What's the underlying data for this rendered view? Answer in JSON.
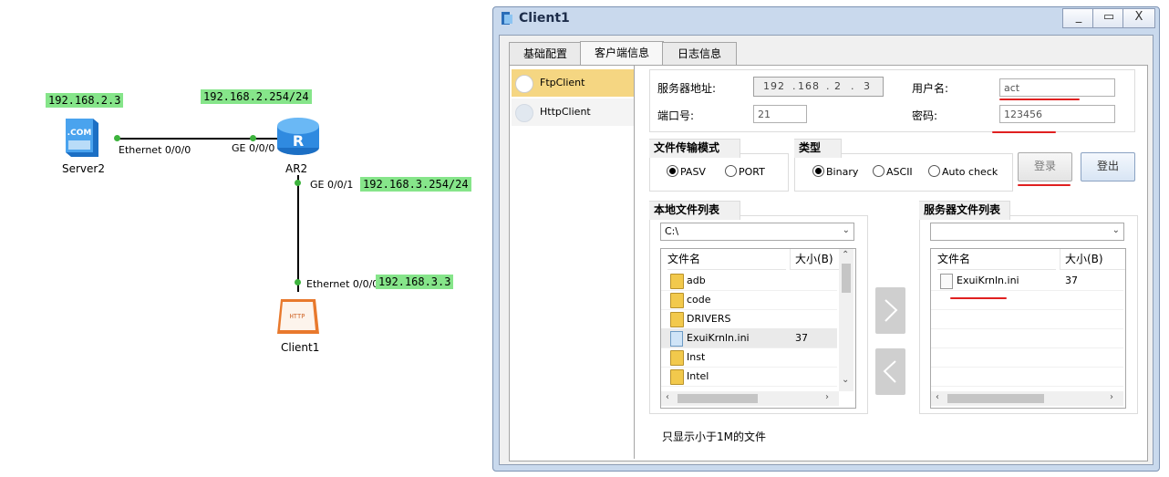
{
  "topology": {
    "devices": {
      "server2": "Server2",
      "ar2": "AR2",
      "client1": "Client1",
      "server_icon_text": ".COM",
      "client_icon_text": "HTTP"
    },
    "ip_labels": {
      "server2": "192.168.2.3",
      "ar2_ge000": "192.168.2.254/24",
      "ar2_ge001": "192.168.3.254/24",
      "client1": "192.168.3.3"
    },
    "ports": {
      "server2_eth": "Ethernet 0/0/0",
      "ar2_ge000": "GE 0/0/0",
      "ar2_ge001": "GE 0/0/1",
      "client1_eth": "Ethernet 0/0/0"
    }
  },
  "window": {
    "title": "Client1",
    "controls": {
      "minimize": "_",
      "maximize": "▭",
      "close": "X"
    },
    "tabs": [
      "基础配置",
      "客户端信息",
      "日志信息"
    ],
    "active_tab": 1,
    "sidebar": {
      "items": [
        "FtpClient",
        "HttpClient"
      ],
      "selected": 0
    },
    "ftp": {
      "server_addr_label": "服务器地址:",
      "server_addr_octets": [
        "192",
        "168",
        "2",
        "3"
      ],
      "port_label": "端口号:",
      "port_value": "21",
      "username_label": "用户名:",
      "username_value": "act",
      "password_label": "密码:",
      "password_value": "123456",
      "mode_group": {
        "title": "文件传输模式",
        "options": [
          "PASV",
          "PORT"
        ],
        "selected": "PASV"
      },
      "type_group": {
        "title": "类型",
        "options": [
          "Binary",
          "ASCII",
          "Auto check"
        ],
        "selected": "Binary"
      },
      "login_button": "登录",
      "logout_button": "登出",
      "local": {
        "title": "本地文件列表",
        "path": "C:\\",
        "columns": [
          "文件名",
          "大小(B)"
        ],
        "rows": [
          {
            "name": "adb",
            "size": "",
            "type": "folder"
          },
          {
            "name": "code",
            "size": "",
            "type": "folder"
          },
          {
            "name": "DRIVERS",
            "size": "",
            "type": "folder"
          },
          {
            "name": "ExuiKrnln.ini",
            "size": "37",
            "type": "file"
          },
          {
            "name": "Inst",
            "size": "",
            "type": "folder"
          },
          {
            "name": "Intel",
            "size": "",
            "type": "folder"
          }
        ]
      },
      "remote": {
        "title": "服务器文件列表",
        "path": "",
        "columns": [
          "文件名",
          "大小(B)"
        ],
        "rows": [
          {
            "name": "ExuiKrnln.ini",
            "size": "37",
            "type": "file"
          }
        ]
      },
      "upload_arrow": ">",
      "download_arrow": "<",
      "footer_note": "只显示小于1M的文件"
    }
  },
  "colors": {
    "ip_label_bg": "#86e58a",
    "annotation_red": "#e02020",
    "selected_sidebar": "#f5d682",
    "window_frame": "#c9d9ed"
  }
}
